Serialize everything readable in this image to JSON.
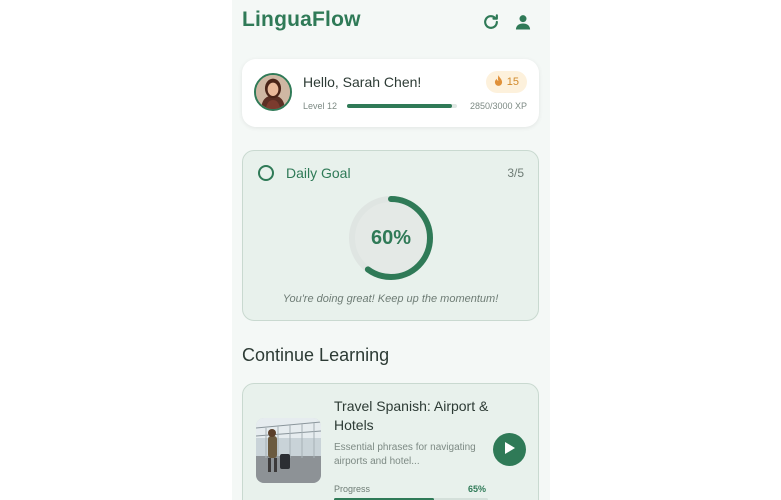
{
  "app": {
    "title": "LinguaFlow"
  },
  "header": {
    "icons": [
      "refresh-icon",
      "user-icon"
    ]
  },
  "profile": {
    "greeting": "Hello, Sarah Chen!",
    "streak": "15",
    "level": "Level 12",
    "xp": "2850/3000 XP",
    "xp_progress": 0.95
  },
  "daily_goal": {
    "title": "Daily Goal",
    "count": "3/5",
    "percent_label": "60%",
    "percent": 0.6,
    "message": "You're doing great! Keep up the momentum!"
  },
  "continue": {
    "title": "Continue Learning",
    "course": {
      "title": "Travel Spanish: Airport & Hotels",
      "description": "Essential phrases for navigating airports and hotel...",
      "progress_label": "Progress",
      "progress_pct": "65%",
      "progress": 0.65
    }
  },
  "colors": {
    "accent": "#2f7a57",
    "streak": "#d18a2c",
    "card_bg": "#e8f1ec"
  }
}
